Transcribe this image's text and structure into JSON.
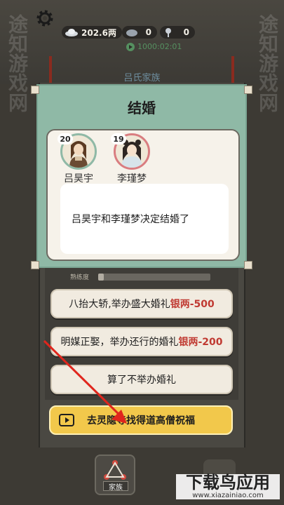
{
  "hud": {
    "silver": "202.6两",
    "res2": "0",
    "res3": "0",
    "timer": "1000:02:01"
  },
  "clan": {
    "title": "吕氏家族"
  },
  "modal": {
    "title": "结婚",
    "groom": {
      "name": "吕昊宇",
      "age": "20"
    },
    "bride": {
      "name": "李瑾梦",
      "age": "19"
    },
    "message": "吕昊宇和李瑾梦决定结婚了"
  },
  "skill_label": "熟练度",
  "skill_level": 0.05,
  "options": [
    {
      "text": "八抬大轿,举办盛大婚礼",
      "cost": "银两-500"
    },
    {
      "text": "明媒正娶，举办还行的婚礼",
      "cost": "银两-200"
    },
    {
      "text": "算了不举办婚礼",
      "cost": ""
    }
  ],
  "video_option": {
    "text": "去灵隐寺找得道高僧祝福"
  },
  "bottom_nav": {
    "family_label": "家族"
  },
  "watermark": {
    "main": "下载鸟应用",
    "url": "www.xiazainiao.com",
    "side": "途知游戏网"
  },
  "colors": {
    "accent": "#8fb9a6",
    "cost": "#c03a32",
    "video": "#f2c84b"
  }
}
